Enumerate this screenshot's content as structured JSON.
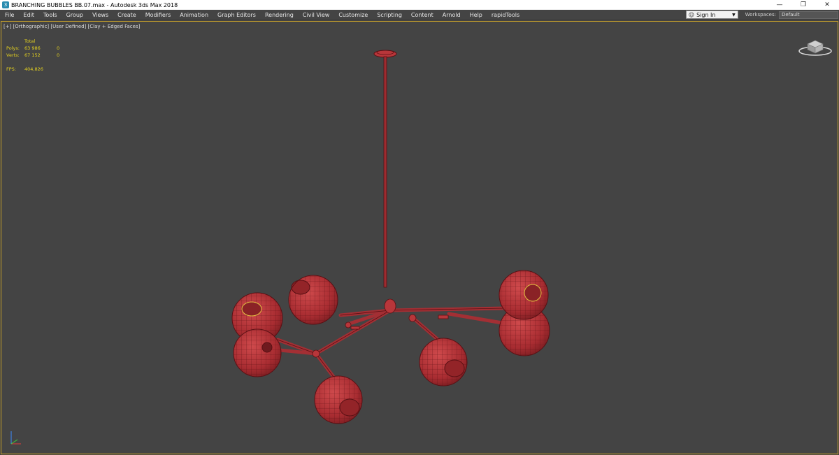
{
  "window": {
    "title": "BRANCHING BUBBLES BB.07.max - Autodesk 3ds Max 2018",
    "app_icon": "3",
    "minimize_glyph": "—",
    "restore_glyph": "❐",
    "close_glyph": "✕"
  },
  "menubar": {
    "items": [
      "File",
      "Edit",
      "Tools",
      "Group",
      "Views",
      "Create",
      "Modifiers",
      "Animation",
      "Graph Editors",
      "Rendering",
      "Civil View",
      "Customize",
      "Scripting",
      "Content",
      "Arnold",
      "Help",
      "rapidTools"
    ],
    "signin_label": "Sign In",
    "workspaces_label": "Workspaces:",
    "workspace_value": "Default"
  },
  "viewport": {
    "label": "[+] [Orthographic] [User Defined] [Clay + Edged Faces]",
    "stats": {
      "header": "Total",
      "polys_label": "Polys:",
      "polys_value": "63 986",
      "polys_sel": "0",
      "verts_label": "Verts:",
      "verts_value": "67 152",
      "verts_sel": "0",
      "fps_label": "FPS:",
      "fps_value": "404,826"
    }
  },
  "colors": {
    "background": "#444444",
    "stats_text": "#e5d21f",
    "mesh_fill": "#b8363a",
    "mesh_edge": "#5a1014",
    "active_border": "#c7a12a"
  },
  "icons": {
    "viewcube": "viewcube-icon",
    "axis": "axis-tripod-icon",
    "user": "user-icon",
    "dropdown": "chevron-down-icon"
  }
}
